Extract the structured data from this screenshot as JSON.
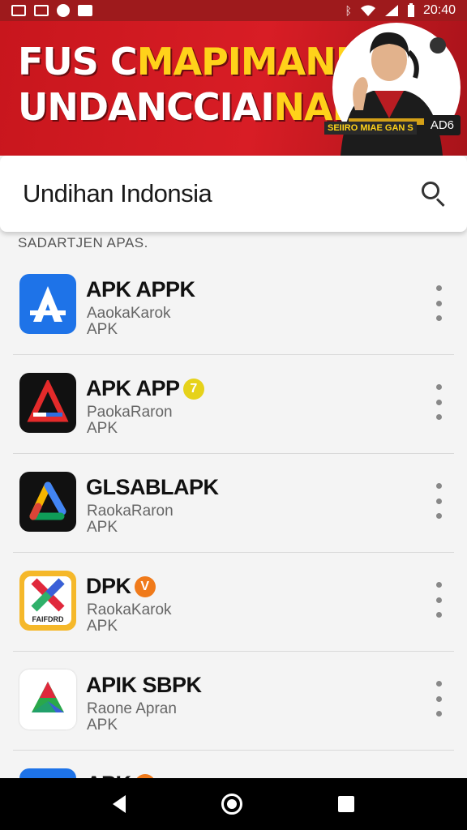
{
  "status_bar": {
    "time": "20:40",
    "left_icons": [
      "gallery-icon",
      "image-icon",
      "messenger-icon",
      "notification-icon"
    ],
    "right_icons": [
      "bluetooth-icon",
      "wifi-icon",
      "signal-icon",
      "battery-icon"
    ]
  },
  "banner": {
    "line1_white": "FUS C",
    "line1_yellow": "MAPIMANN",
    "line2_white": "UNDANCCIAI",
    "line2_yellow": "NAM",
    "ads_label": "AD6",
    "strip_text": "SEIIRO MIAE GAN S",
    "colors": {
      "background": "#d81d25",
      "highlight": "#ffd21a"
    }
  },
  "search": {
    "title": "Undihan Indonsia",
    "icon": "search-icon"
  },
  "section": {
    "label": "SADARTJEN APAS."
  },
  "apps": [
    {
      "name": "APK APPK",
      "badge": "",
      "subtitle": "AaokaKarok",
      "type": "APK",
      "icon": "app-store-a-icon",
      "icon_bg": "#1e73e8"
    },
    {
      "name": "APK APP",
      "badge": "7",
      "badge_color": "#e6d21a",
      "subtitle": "PaokaRaron",
      "type": "APK",
      "icon": "red-a-triangle-icon",
      "icon_bg": "#111111"
    },
    {
      "name": "GLSABLAPK",
      "badge": "",
      "subtitle": "RaokaRaron",
      "type": "APK",
      "icon": "google-triangle-icon",
      "icon_bg": "#111111"
    },
    {
      "name": "DPK",
      "badge": "V",
      "badge_color": "#f07a1a",
      "subtitle": "RaokaKarok",
      "type": "APK",
      "icon": "x-logo-icon",
      "icon_bg": "#f5b82a",
      "icon_caption": "FAIFDRD"
    },
    {
      "name": "APIK SBPK",
      "badge": "",
      "subtitle": "Raone Apran",
      "type": "APK",
      "icon": "green-triangle-icon",
      "icon_bg": "#ffffff"
    },
    {
      "name": "APK",
      "badge": "V",
      "badge_color": "#f07a1a",
      "subtitle": "",
      "type": "",
      "icon": "green-circle-icon",
      "icon_bg": "#1e73e8"
    }
  ]
}
